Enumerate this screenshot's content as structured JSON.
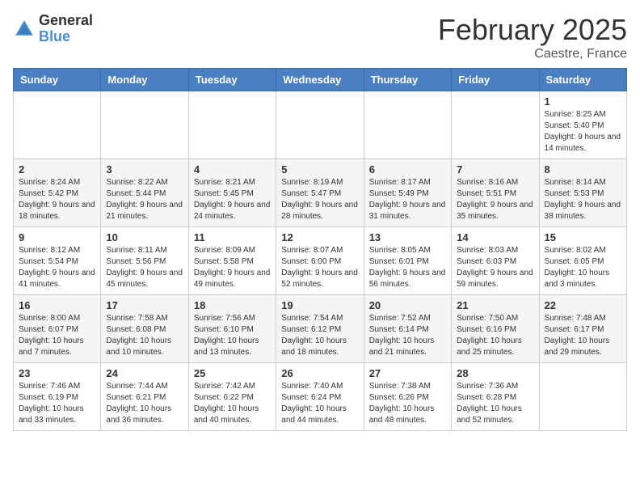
{
  "header": {
    "logo_general": "General",
    "logo_blue": "Blue",
    "title": "February 2025",
    "subtitle": "Caestre, France"
  },
  "weekdays": [
    "Sunday",
    "Monday",
    "Tuesday",
    "Wednesday",
    "Thursday",
    "Friday",
    "Saturday"
  ],
  "weeks": [
    [
      {
        "day": "",
        "info": ""
      },
      {
        "day": "",
        "info": ""
      },
      {
        "day": "",
        "info": ""
      },
      {
        "day": "",
        "info": ""
      },
      {
        "day": "",
        "info": ""
      },
      {
        "day": "",
        "info": ""
      },
      {
        "day": "1",
        "info": "Sunrise: 8:25 AM\nSunset: 5:40 PM\nDaylight: 9 hours and 14 minutes."
      }
    ],
    [
      {
        "day": "2",
        "info": "Sunrise: 8:24 AM\nSunset: 5:42 PM\nDaylight: 9 hours and 18 minutes."
      },
      {
        "day": "3",
        "info": "Sunrise: 8:22 AM\nSunset: 5:44 PM\nDaylight: 9 hours and 21 minutes."
      },
      {
        "day": "4",
        "info": "Sunrise: 8:21 AM\nSunset: 5:45 PM\nDaylight: 9 hours and 24 minutes."
      },
      {
        "day": "5",
        "info": "Sunrise: 8:19 AM\nSunset: 5:47 PM\nDaylight: 9 hours and 28 minutes."
      },
      {
        "day": "6",
        "info": "Sunrise: 8:17 AM\nSunset: 5:49 PM\nDaylight: 9 hours and 31 minutes."
      },
      {
        "day": "7",
        "info": "Sunrise: 8:16 AM\nSunset: 5:51 PM\nDaylight: 9 hours and 35 minutes."
      },
      {
        "day": "8",
        "info": "Sunrise: 8:14 AM\nSunset: 5:53 PM\nDaylight: 9 hours and 38 minutes."
      }
    ],
    [
      {
        "day": "9",
        "info": "Sunrise: 8:12 AM\nSunset: 5:54 PM\nDaylight: 9 hours and 41 minutes."
      },
      {
        "day": "10",
        "info": "Sunrise: 8:11 AM\nSunset: 5:56 PM\nDaylight: 9 hours and 45 minutes."
      },
      {
        "day": "11",
        "info": "Sunrise: 8:09 AM\nSunset: 5:58 PM\nDaylight: 9 hours and 49 minutes."
      },
      {
        "day": "12",
        "info": "Sunrise: 8:07 AM\nSunset: 6:00 PM\nDaylight: 9 hours and 52 minutes."
      },
      {
        "day": "13",
        "info": "Sunrise: 8:05 AM\nSunset: 6:01 PM\nDaylight: 9 hours and 56 minutes."
      },
      {
        "day": "14",
        "info": "Sunrise: 8:03 AM\nSunset: 6:03 PM\nDaylight: 9 hours and 59 minutes."
      },
      {
        "day": "15",
        "info": "Sunrise: 8:02 AM\nSunset: 6:05 PM\nDaylight: 10 hours and 3 minutes."
      }
    ],
    [
      {
        "day": "16",
        "info": "Sunrise: 8:00 AM\nSunset: 6:07 PM\nDaylight: 10 hours and 7 minutes."
      },
      {
        "day": "17",
        "info": "Sunrise: 7:58 AM\nSunset: 6:08 PM\nDaylight: 10 hours and 10 minutes."
      },
      {
        "day": "18",
        "info": "Sunrise: 7:56 AM\nSunset: 6:10 PM\nDaylight: 10 hours and 13 minutes."
      },
      {
        "day": "19",
        "info": "Sunrise: 7:54 AM\nSunset: 6:12 PM\nDaylight: 10 hours and 18 minutes."
      },
      {
        "day": "20",
        "info": "Sunrise: 7:52 AM\nSunset: 6:14 PM\nDaylight: 10 hours and 21 minutes."
      },
      {
        "day": "21",
        "info": "Sunrise: 7:50 AM\nSunset: 6:16 PM\nDaylight: 10 hours and 25 minutes."
      },
      {
        "day": "22",
        "info": "Sunrise: 7:48 AM\nSunset: 6:17 PM\nDaylight: 10 hours and 29 minutes."
      }
    ],
    [
      {
        "day": "23",
        "info": "Sunrise: 7:46 AM\nSunset: 6:19 PM\nDaylight: 10 hours and 33 minutes."
      },
      {
        "day": "24",
        "info": "Sunrise: 7:44 AM\nSunset: 6:21 PM\nDaylight: 10 hours and 36 minutes."
      },
      {
        "day": "25",
        "info": "Sunrise: 7:42 AM\nSunset: 6:22 PM\nDaylight: 10 hours and 40 minutes."
      },
      {
        "day": "26",
        "info": "Sunrise: 7:40 AM\nSunset: 6:24 PM\nDaylight: 10 hours and 44 minutes."
      },
      {
        "day": "27",
        "info": "Sunrise: 7:38 AM\nSunset: 6:26 PM\nDaylight: 10 hours and 48 minutes."
      },
      {
        "day": "28",
        "info": "Sunrise: 7:36 AM\nSunset: 6:28 PM\nDaylight: 10 hours and 52 minutes."
      },
      {
        "day": "",
        "info": ""
      }
    ]
  ]
}
